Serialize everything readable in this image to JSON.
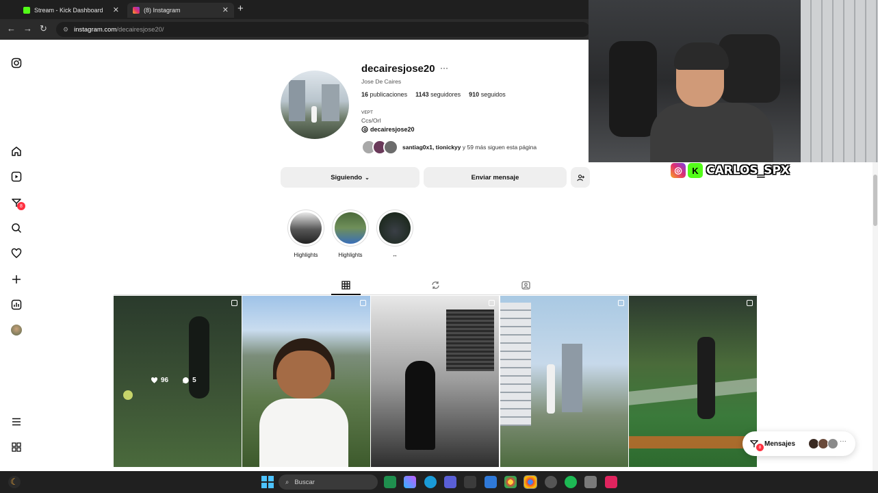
{
  "browser": {
    "tabs": [
      {
        "title": "Stream - Kick Dashboard",
        "active": false,
        "color": "#53fc18"
      },
      {
        "title": "(8) Instagram",
        "active": true,
        "color": "#e1306c"
      }
    ],
    "url_domain": "instagram.com",
    "url_path": "/decairesjose20/"
  },
  "sidebar": {
    "items": [
      "instagram-logo-icon",
      "home-icon",
      "reels-icon",
      "messages-icon",
      "search-icon",
      "notifications-icon",
      "create-icon",
      "dashboard-icon",
      "profile-avatar",
      "menu-icon",
      "apps-icon"
    ],
    "messages_badge": "8"
  },
  "profile": {
    "username": "decairesjose20",
    "more_glyph": "···",
    "full_name": "Jose De Caires",
    "posts_count": "16",
    "posts_label": "publicaciones",
    "followers_count": "1143",
    "followers_label": "seguidores",
    "following_count": "910",
    "following_label": "seguidos",
    "bio_line1": "VEPT",
    "bio_line2": "Ccs/Orl",
    "threads_handle": "decairesjose20",
    "followed_by_names": "santiag0x1, tionickyy",
    "followed_by_rest": " y 59 más siguen esta página"
  },
  "actions": {
    "following_label": "Siguiendo",
    "message_label": "Enviar mensaje"
  },
  "highlights": [
    {
      "label": "Highlights"
    },
    {
      "label": "Highlights"
    },
    {
      "label": "↔"
    }
  ],
  "posts": {
    "hover_likes": "96",
    "hover_comments": "5"
  },
  "messages_pill": {
    "label": "Mensajes",
    "badge": "8"
  },
  "overlay": {
    "streamer_name": "CARLOS_SPX",
    "kick_letter": "K"
  },
  "taskbar": {
    "search_placeholder": "Buscar"
  }
}
